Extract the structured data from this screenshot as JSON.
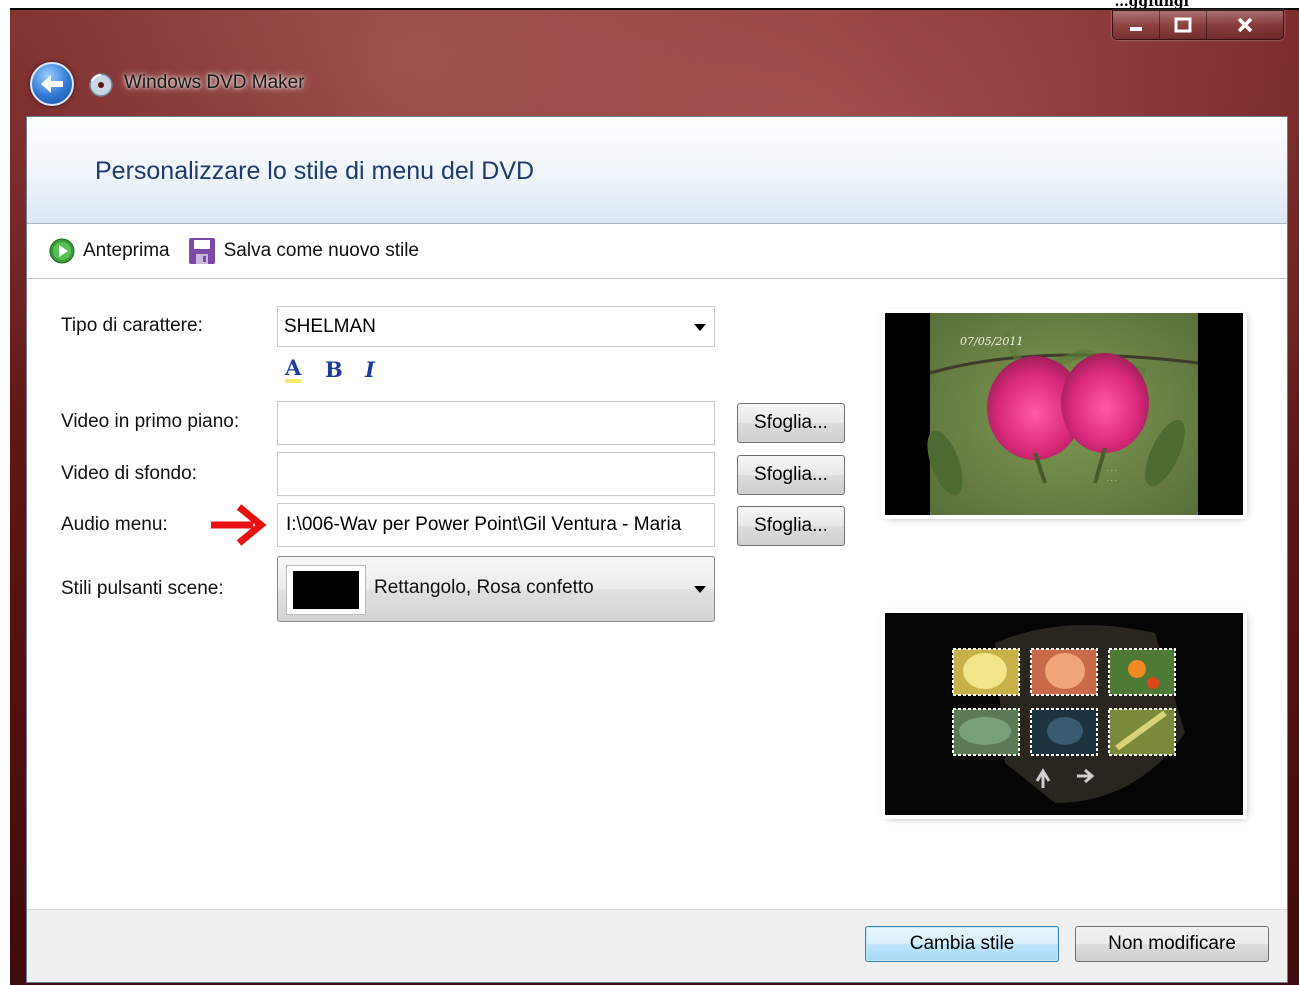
{
  "window": {
    "app_title": "Windows DVD Maker",
    "top_right_partial_text": "…ggiungi",
    "caption_buttons": [
      "minimize",
      "maximize",
      "close"
    ]
  },
  "header": {
    "title": "Personalizzare lo stile di menu del DVD"
  },
  "toolbar": {
    "preview_label": "Anteprima",
    "save_style_label": "Salva come nuovo stile"
  },
  "form": {
    "font_label": "Tipo di carattere:",
    "font_value": "SHELMAN",
    "format_buttons": {
      "color": "A",
      "bold": "B",
      "italic": "I"
    },
    "foreground_video_label": "Video in primo piano:",
    "foreground_video_value": "",
    "background_video_label": "Video di sfondo:",
    "background_video_value": "",
    "audio_menu_label": "Audio menu:",
    "audio_menu_value": "I:\\006-Wav per Power Point\\Gil Ventura - Maria",
    "scene_buttons_label": "Stili pulsanti scene:",
    "scene_buttons_value": "Rettangolo, Rosa confetto",
    "browse_label": "Sfoglia...",
    "arrow_color": "#e81010"
  },
  "previews": {
    "main_menu_date": "07/05/2011",
    "main_menu_subject": "pink flowers photo",
    "scenes_subject": "flower thumbnails grid"
  },
  "footer": {
    "change_style_label": "Cambia stile",
    "cancel_label": "Non modificare"
  },
  "colors": {
    "title_blue": "#1f3a6b",
    "frame_red": "#5c1414",
    "format_blue": "#1d3d9c"
  }
}
